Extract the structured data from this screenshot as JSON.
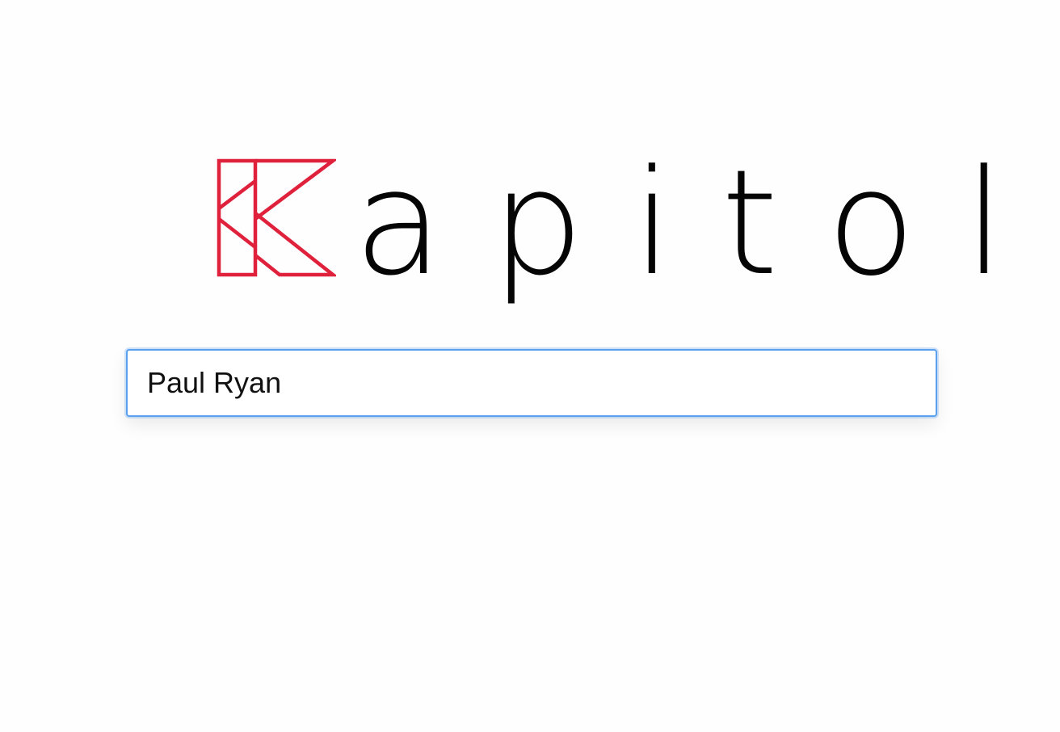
{
  "brand": {
    "name_rest": "apitol",
    "logo_letter": "K",
    "accent_color": "#e0213c",
    "text_color": "#050505"
  },
  "search": {
    "value": "Paul Ryan",
    "focus_ring_color": "#5aa0ef"
  }
}
